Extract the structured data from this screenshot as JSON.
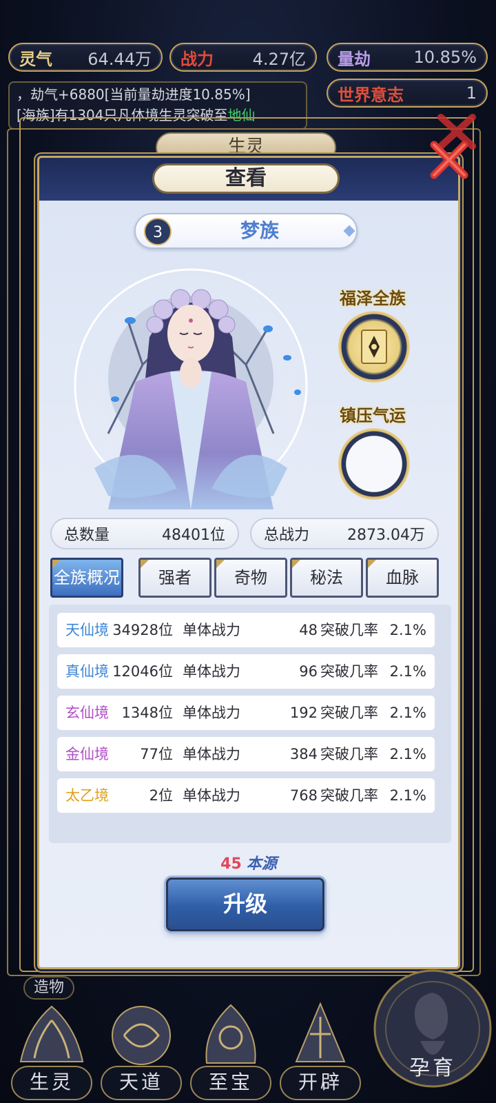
{
  "hud": {
    "lingqi": {
      "label": "灵气",
      "value": "64.44万"
    },
    "zhanli": {
      "label": "战力",
      "value": "4.27亿"
    },
    "liangjie": {
      "label": "量劫",
      "value": "10.85%"
    },
    "world_will": {
      "label": "世界意志",
      "value": "1"
    }
  },
  "log": {
    "line1": "，劫气+6880[当前量劫进度10.85%]",
    "line2_prefix": "[海族]有1304只凡体境生灵突破至",
    "line2_highlight": "地仙"
  },
  "background_tab": "生灵",
  "panel": {
    "title": "查看",
    "tribe": {
      "level": "3",
      "name": "梦族"
    },
    "blessing_label": "福泽全族",
    "suppress_label": "镇压气运",
    "total_count": {
      "label": "总数量",
      "value": "48401位"
    },
    "total_power": {
      "label": "总战力",
      "value": "2873.04万"
    },
    "tabs": [
      {
        "label": "全族概况",
        "active": true
      },
      {
        "label": "强者",
        "active": false
      },
      {
        "label": "奇物",
        "active": false
      },
      {
        "label": "秘法",
        "active": false
      },
      {
        "label": "血脉",
        "active": false
      }
    ],
    "rows": [
      {
        "realm": "天仙境",
        "color": "#3f86d6",
        "count": "34928位",
        "power_label": "单体战力",
        "power": "48",
        "break_label": "突破几率",
        "rate": "2.1%"
      },
      {
        "realm": "真仙境",
        "color": "#3f86d6",
        "count": "12046位",
        "power_label": "单体战力",
        "power": "96",
        "break_label": "突破几率",
        "rate": "2.1%"
      },
      {
        "realm": "玄仙境",
        "color": "#b24fc8",
        "count": "1348位",
        "power_label": "单体战力",
        "power": "192",
        "break_label": "突破几率",
        "rate": "2.1%"
      },
      {
        "realm": "金仙境",
        "color": "#b24fc8",
        "count": "77位",
        "power_label": "单体战力",
        "power": "384",
        "break_label": "突破几率",
        "rate": "2.1%"
      },
      {
        "realm": "太乙境",
        "color": "#e2a11c",
        "count": "2位",
        "power_label": "单体战力",
        "power": "768",
        "break_label": "突破几率",
        "rate": "2.1%"
      }
    ],
    "source": {
      "amount": "45",
      "label": "本源"
    },
    "upgrade_label": "升级"
  },
  "bottom_nav": {
    "zaowu": "造物",
    "items": [
      {
        "label": "生灵",
        "icon": "phoenix-emblem-icon"
      },
      {
        "label": "天道",
        "icon": "swirl-emblem-icon"
      },
      {
        "label": "至宝",
        "icon": "treasure-emblem-icon"
      },
      {
        "label": "开辟",
        "icon": "axe-emblem-icon"
      }
    ],
    "nurture": "孕育"
  }
}
